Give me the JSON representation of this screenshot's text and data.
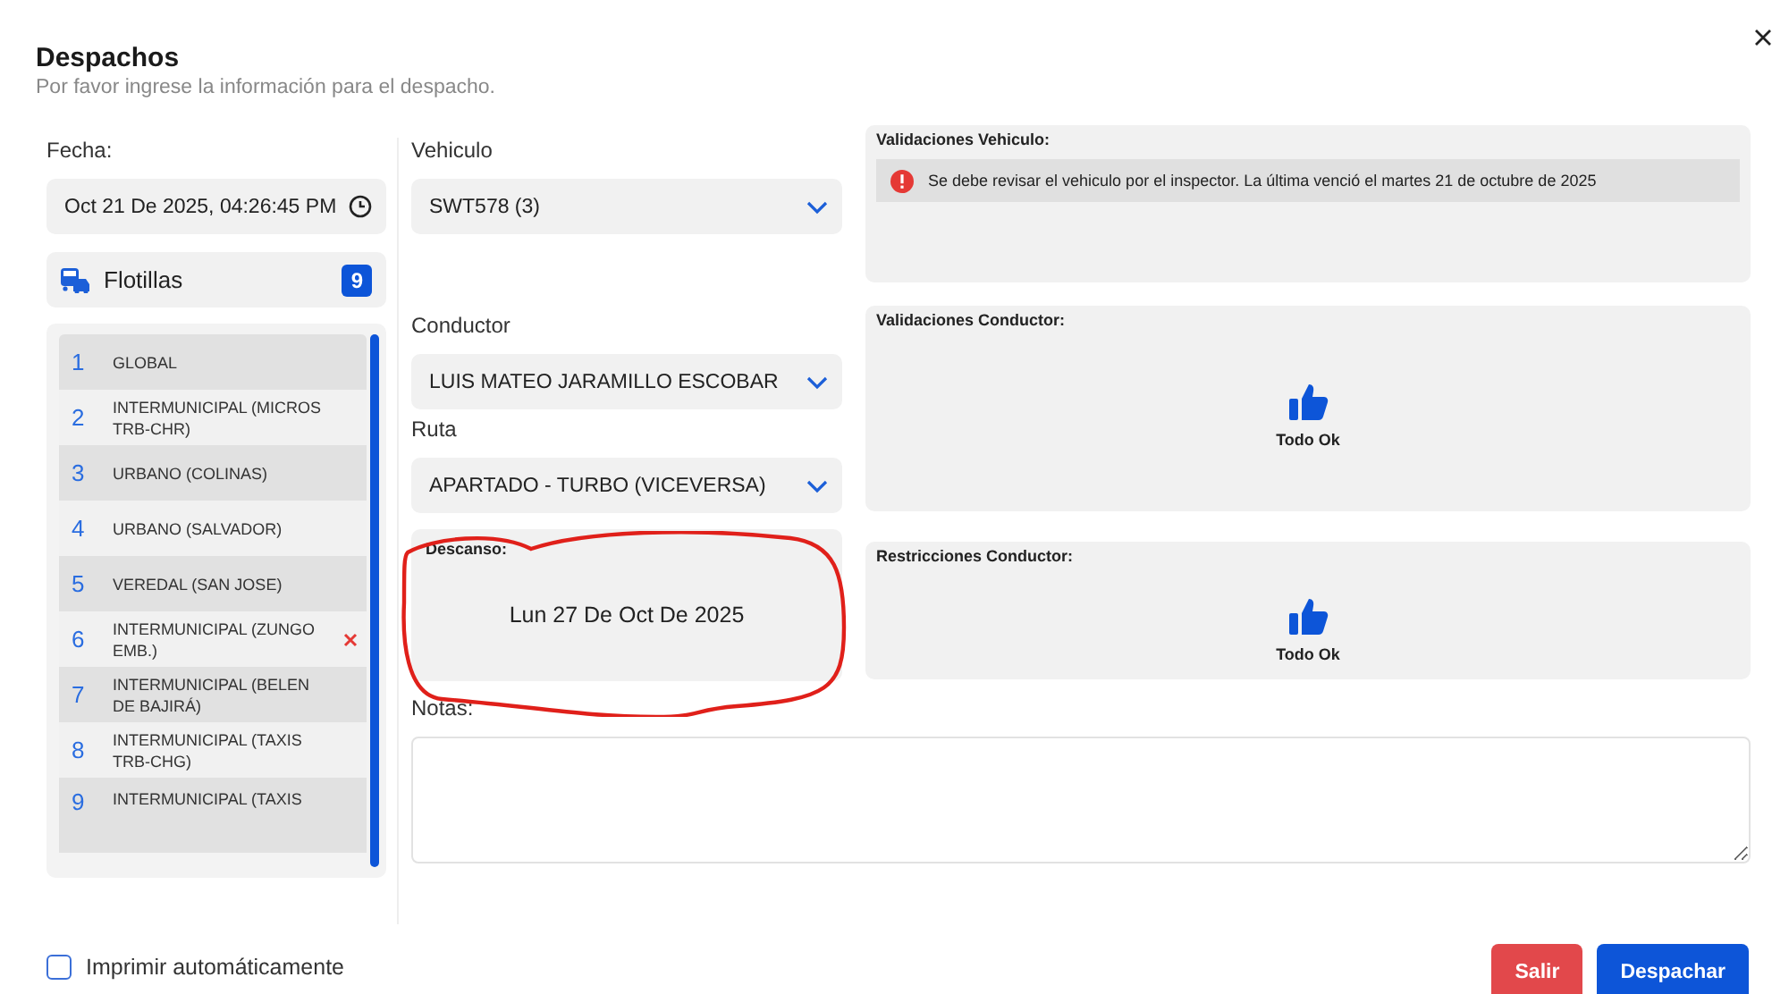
{
  "header": {
    "title": "Despachos",
    "subtitle": "Por favor ingrese la información para el despacho."
  },
  "fecha": {
    "label": "Fecha:",
    "value": "Oct 21 De 2025, 04:26:45 PM"
  },
  "flotillas": {
    "label": "Flotillas",
    "count": "9",
    "items": [
      {
        "number": "1",
        "name": "GLOBAL",
        "flagged": false
      },
      {
        "number": "2",
        "name": "INTERMUNICIPAL (MICROS TRB-CHR)",
        "flagged": false
      },
      {
        "number": "3",
        "name": "URBANO (COLINAS)",
        "flagged": false
      },
      {
        "number": "4",
        "name": "URBANO (SALVADOR)",
        "flagged": false
      },
      {
        "number": "5",
        "name": "VEREDAL (SAN JOSE)",
        "flagged": false
      },
      {
        "number": "6",
        "name": "INTERMUNICIPAL (ZUNGO EMB.)",
        "flagged": true
      },
      {
        "number": "7",
        "name": "INTERMUNICIPAL (BELEN DE BAJIRÁ)",
        "flagged": false
      },
      {
        "number": "8",
        "name": "INTERMUNICIPAL (TAXIS TRB-CHG)",
        "flagged": false
      },
      {
        "number": "9",
        "name": "INTERMUNICIPAL (TAXIS",
        "flagged": false
      }
    ]
  },
  "vehiculo": {
    "label": "Vehiculo",
    "value": "SWT578 (3)"
  },
  "conductor": {
    "label": "Conductor",
    "value": "LUIS MATEO JARAMILLO ESCOBAR"
  },
  "ruta": {
    "label": "Ruta",
    "value": "APARTADO - TURBO (VICEVERSA)"
  },
  "descanso": {
    "label": "Descanso:",
    "value": "Lun 27 De Oct De 2025"
  },
  "notas": {
    "label": "Notas:"
  },
  "panels": [
    {
      "title": "Validaciones Vehiculo:",
      "kind": "alerts",
      "messages": [
        "Se debe revisar el vehiculo por el inspector. La última venció el martes 21 de octubre de 2025"
      ]
    },
    {
      "title": "Validaciones Conductor:",
      "kind": "ok",
      "text": "Todo Ok"
    },
    {
      "title": "Restricciones Conductor:",
      "kind": "ok",
      "text": "Todo Ok"
    }
  ],
  "footer": {
    "auto_print": {
      "label": "Imprimir automáticamente",
      "checked": false
    },
    "buttons": [
      "Salir",
      "Despachar"
    ]
  }
}
